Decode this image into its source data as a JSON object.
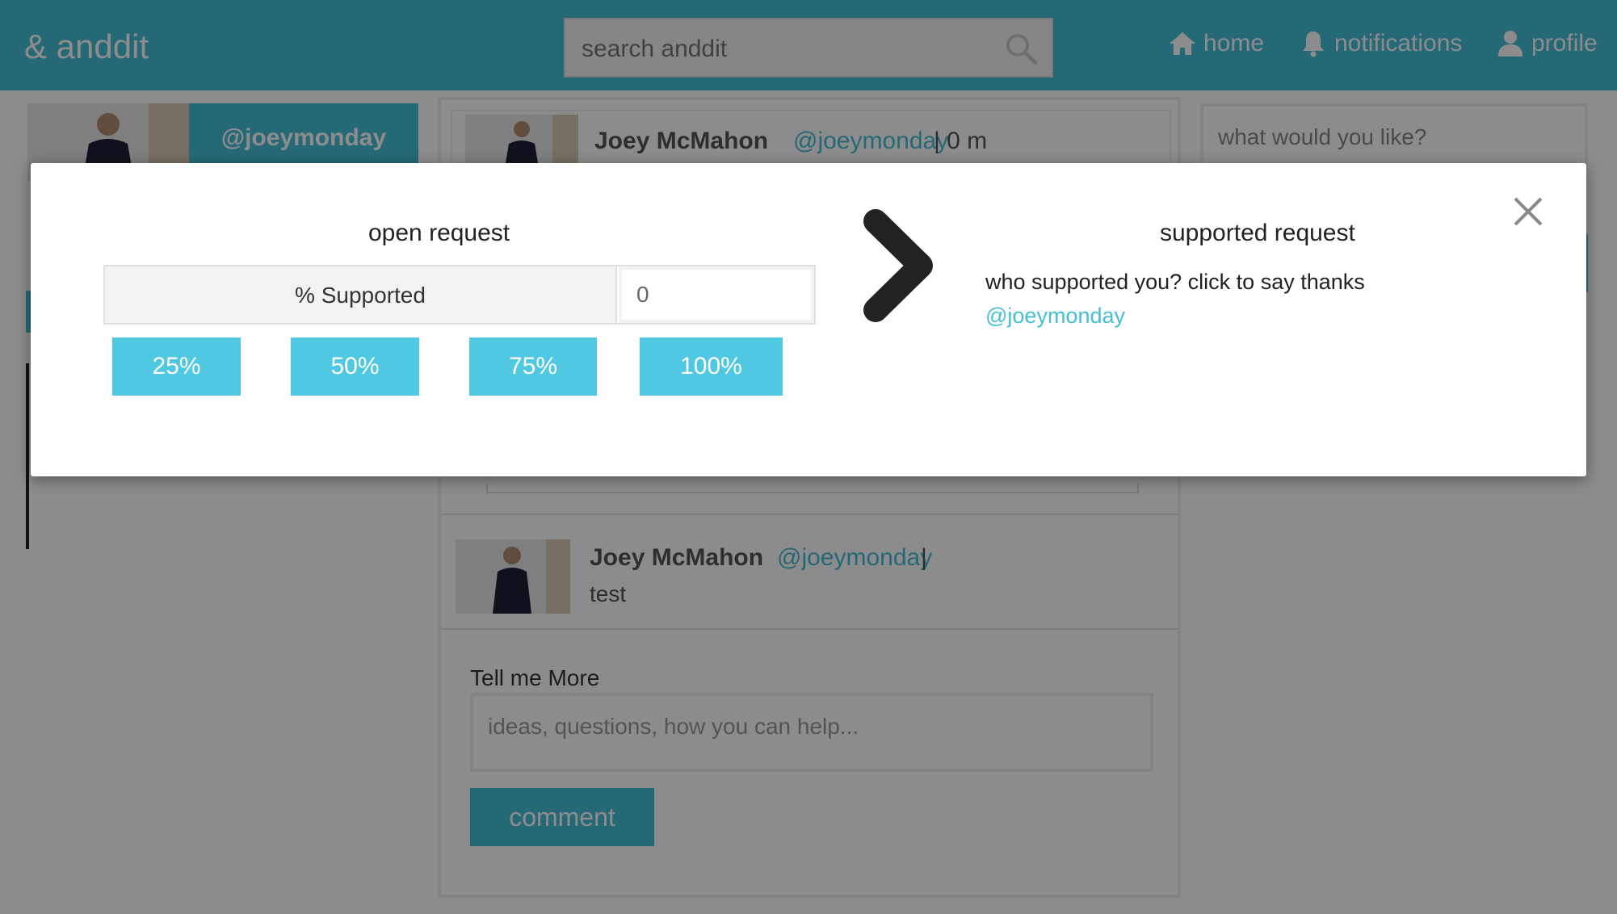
{
  "header": {
    "brand": "& anddit",
    "search_placeholder": "search anddit",
    "nav": {
      "home": "home",
      "notifications": "notifications",
      "profile": "profile"
    }
  },
  "sidebar": {
    "profile_handle": "@joeymonday"
  },
  "feed": {
    "post1": {
      "author": "Joey McMahon",
      "handle": "@joeymonday",
      "meta": "| 0 m"
    },
    "post2": {
      "author": "Joey McMahon",
      "handle": "@joeymonday",
      "meta": "|",
      "body": "test"
    },
    "comment": {
      "label": "Tell me More",
      "placeholder": "ideas, questions, how you can help...",
      "button": "comment"
    }
  },
  "right_panel": {
    "prompt": "what would you like?"
  },
  "modal": {
    "open_title": "open request",
    "supported_label": "% Supported",
    "supported_value": "0",
    "percent_buttons": [
      "25%",
      "50%",
      "75%",
      "100%"
    ],
    "supported_title": "supported request",
    "supported_text": "who supported you? click to say thanks",
    "supported_handle": "@joeymonday"
  },
  "colors": {
    "accent": "#45bfd7",
    "button": "#50c8e2",
    "overlay": "rgba(0,0,0,0.45)"
  }
}
